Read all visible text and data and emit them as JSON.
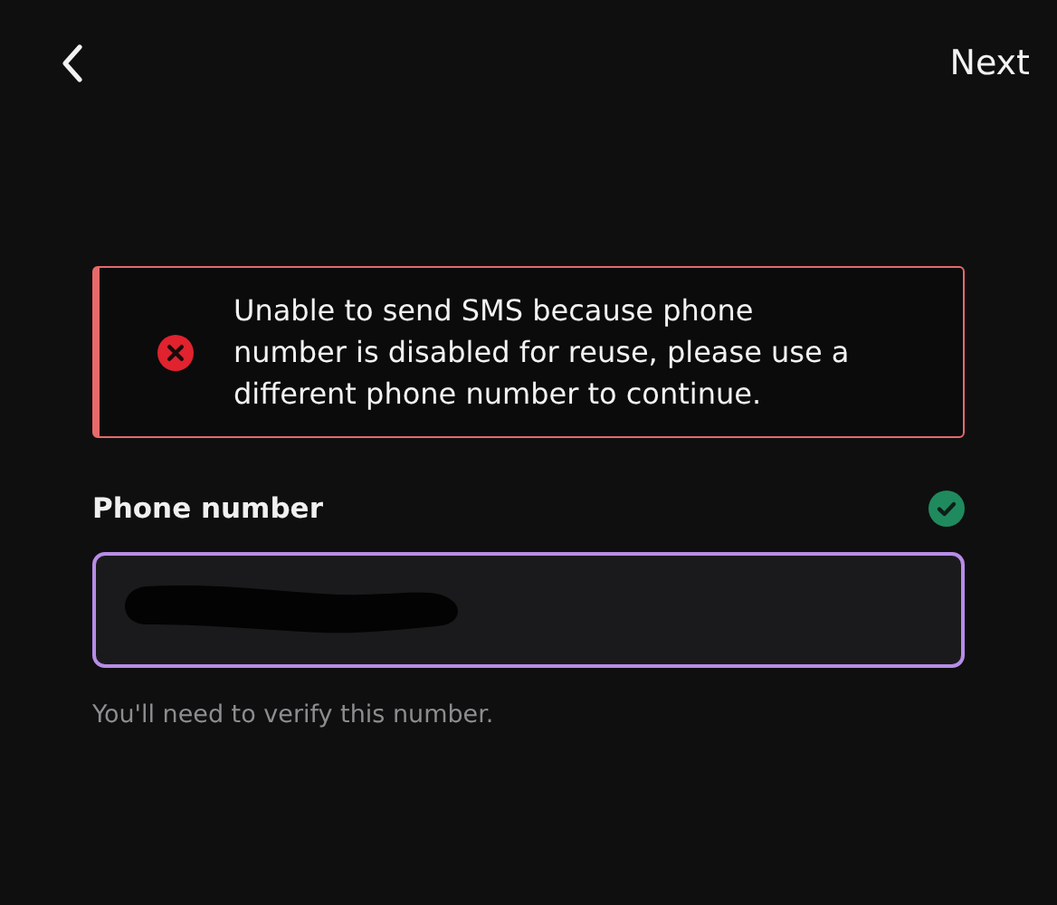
{
  "header": {
    "next_label": "Next"
  },
  "alert": {
    "kind": "error",
    "message": "Unable to send SMS because phone number is disabled for reuse, please use a different phone number to continue."
  },
  "phone_field": {
    "label": "Phone number",
    "verified": true,
    "focused": true,
    "redacted": true,
    "hint": "You'll need to verify this number."
  }
}
